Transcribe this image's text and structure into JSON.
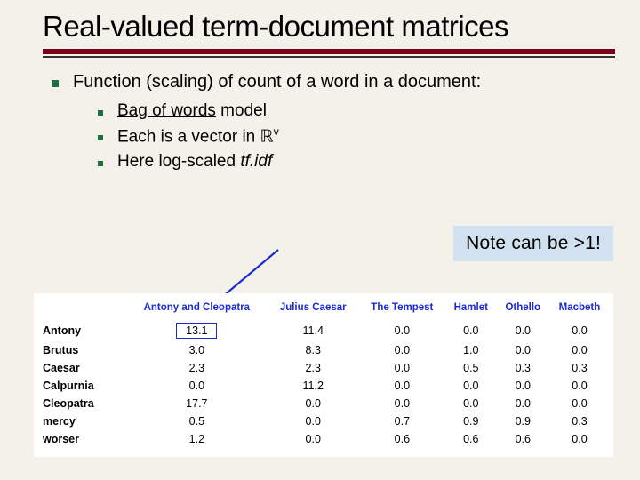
{
  "title": "Real-valued term-document matrices",
  "body": {
    "l1": "Function (scaling) of count of a word in a document:",
    "l2": [
      {
        "pre": "",
        "u": "Bag of words",
        "post": " model"
      },
      {
        "pre": "Each is a vector in ",
        "sym": "ℝ",
        "sup": "v",
        "post": ""
      },
      {
        "pre": "Here log-scaled ",
        "it": "tf.idf",
        "post": ""
      }
    ]
  },
  "callout": "Note can be >1!",
  "chart_data": {
    "type": "table",
    "title": "tf.idf term-document matrix (log-scaled)",
    "columns": [
      "Antony and Cleopatra",
      "Julius Caesar",
      "The Tempest",
      "Hamlet",
      "Othello",
      "Macbeth"
    ],
    "rows": [
      "Antony",
      "Brutus",
      "Caesar",
      "Calpurnia",
      "Cleopatra",
      "mercy",
      "worser"
    ],
    "values": [
      [
        13.1,
        11.4,
        0.0,
        0.0,
        0.0,
        0.0
      ],
      [
        3.0,
        8.3,
        0.0,
        1.0,
        0.0,
        0.0
      ],
      [
        2.3,
        2.3,
        0.0,
        0.5,
        0.3,
        0.3
      ],
      [
        0.0,
        11.2,
        0.0,
        0.0,
        0.0,
        0.0
      ],
      [
        17.7,
        0.0,
        0.0,
        0.0,
        0.0,
        0.0
      ],
      [
        0.5,
        0.0,
        0.7,
        0.9,
        0.9,
        0.3
      ],
      [
        1.2,
        0.0,
        0.6,
        0.6,
        0.6,
        0.0
      ]
    ],
    "highlight": {
      "row": 0,
      "col": 0
    }
  }
}
